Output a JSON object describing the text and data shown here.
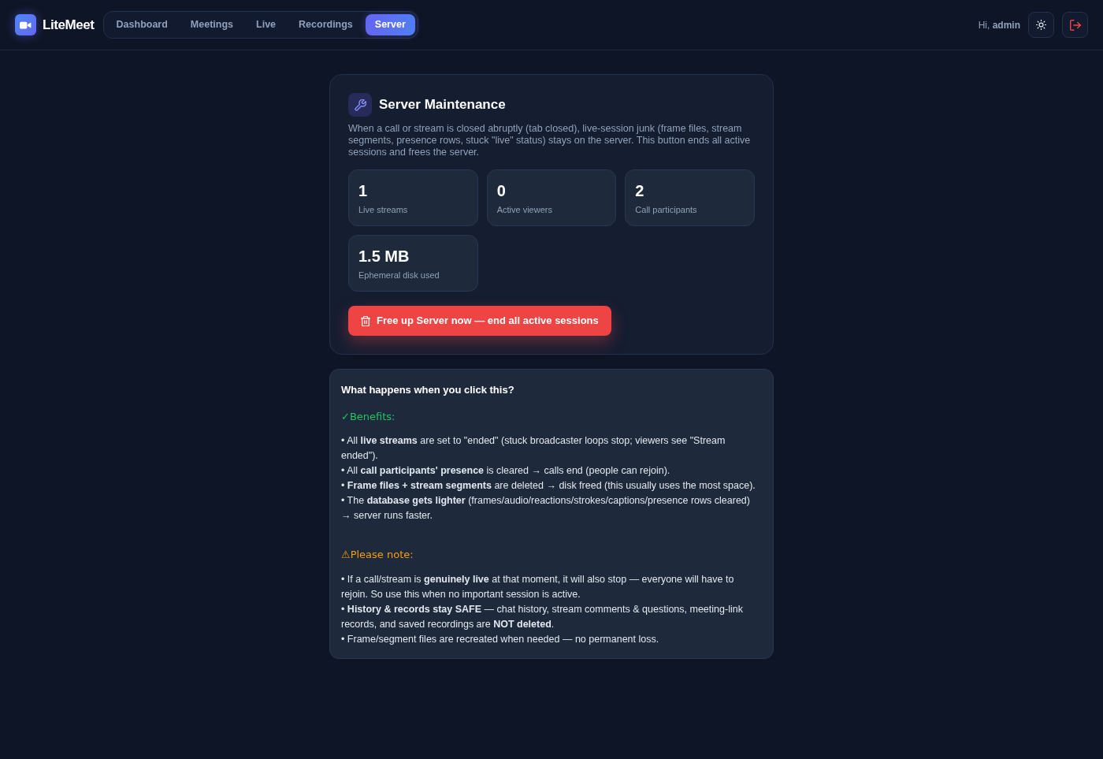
{
  "app": {
    "name": "LiteMeet"
  },
  "nav": [
    {
      "label": "Dashboard",
      "selected": false
    },
    {
      "label": "Meetings",
      "selected": false
    },
    {
      "label": "Live",
      "selected": false
    },
    {
      "label": "Recordings",
      "selected": false
    },
    {
      "label": "Server",
      "selected": true
    }
  ],
  "user": {
    "greeting": "Hi, **admin**"
  },
  "maintenance": {
    "title": "Server Maintenance",
    "description": "When a call or stream is closed abruptly (tab closed), live-session junk (frame files, stream segments, presence rows, stuck \"live\" status) stays on the server. This button ends all active sessions and frees the server.",
    "stats": [
      {
        "value": "1",
        "label": "Live streams"
      },
      {
        "value": "0",
        "label": "Active viewers"
      },
      {
        "value": "2",
        "label": "Call participants"
      },
      {
        "value": "1.5 MB",
        "label": "Ephemeral disk used"
      }
    ],
    "action": "Free up Server now — end all active sessions"
  },
  "info": {
    "title": "What happens when you click this?",
    "sections": [
      {
        "kind": "benefit",
        "heading": "✓Benefits:",
        "items": [
          "• All **live streams** are set to \"ended\" (stuck broadcaster loops stop; viewers see \"Stream ended\").",
          "• All **call participants' presence** is cleared → calls end (people can rejoin).",
          "• **Frame files + stream segments** are deleted → disk freed (this usually uses the most space).",
          "• The **database gets lighter** (frames/audio/reactions/strokes/captions/presence rows cleared) → server runs faster."
        ]
      },
      {
        "kind": "warning",
        "heading": "⚠Please note:",
        "items": [
          "• If a call/stream is **genuinely live** at that moment, it will also stop — everyone will have to rejoin. So use this when no important session is active.",
          "• **History & records stay SAFE** — chat history, stream comments & questions, meeting-link records, and saved recordings are **NOT deleted**.",
          "• Frame/segment files are recreated when needed — no permanent loss."
        ]
      }
    ]
  }
}
